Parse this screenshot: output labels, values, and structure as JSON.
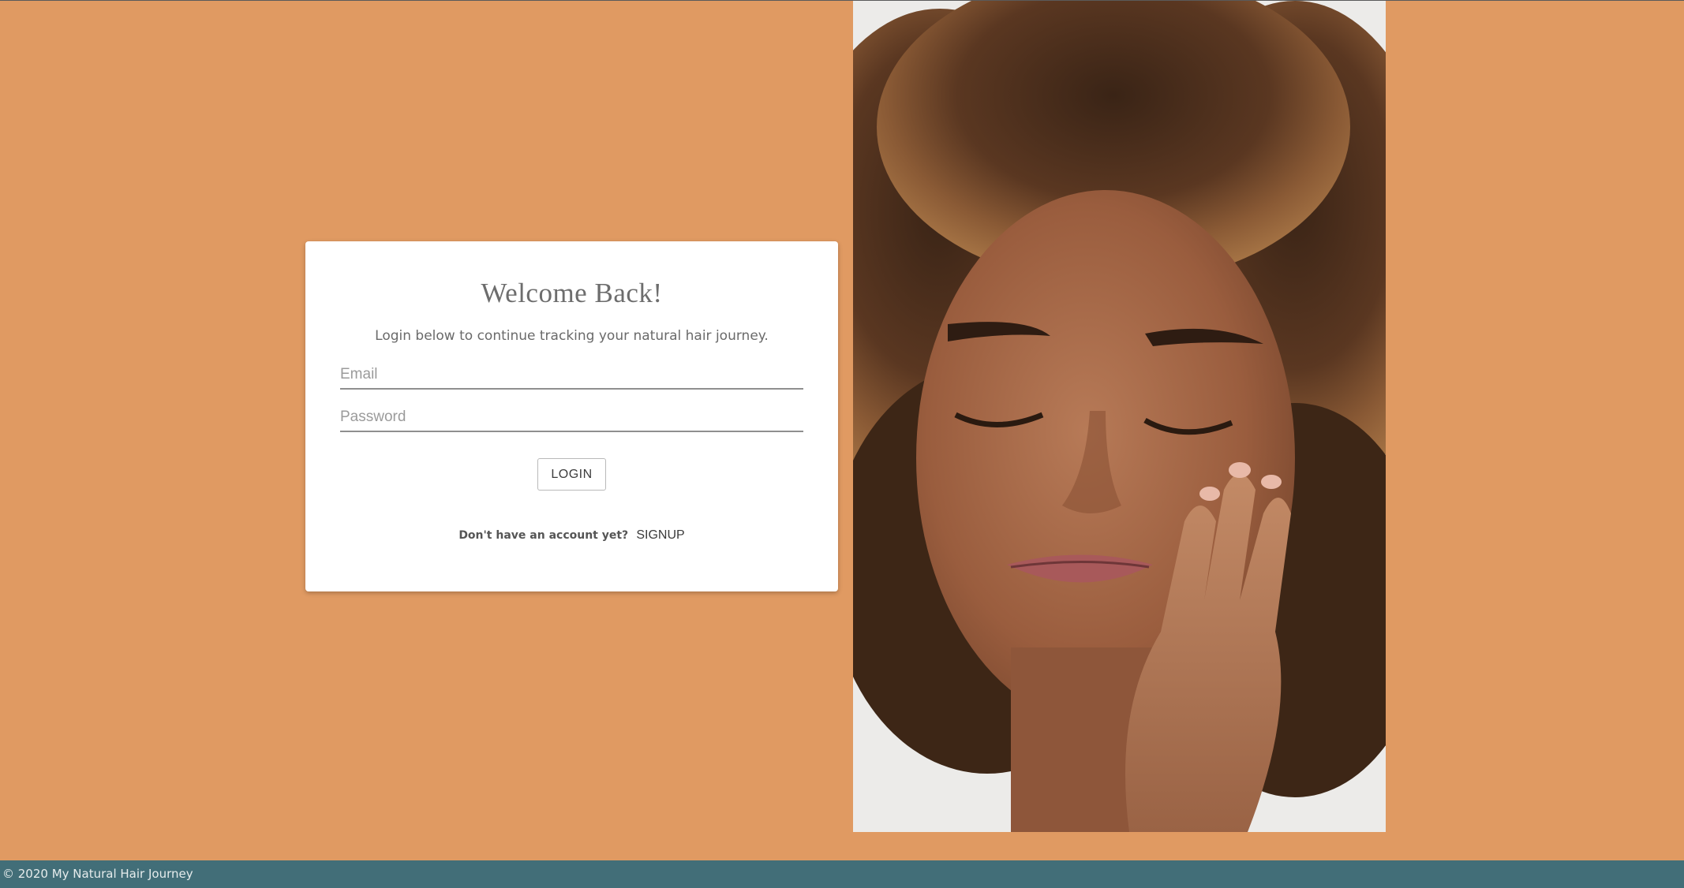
{
  "login": {
    "title": "Welcome Back!",
    "subtitle": "Login below to continue tracking your natural hair journey.",
    "email_placeholder": "Email",
    "email_value": "",
    "password_placeholder": "Password",
    "password_value": "",
    "login_label": "LOGIN",
    "signup_prompt": "Don't have an account yet?",
    "signup_label": "SIGNUP"
  },
  "hero": {
    "image_subject": "woman-with-curly-hair-eyes-closed"
  },
  "footer": {
    "copyright": "© 2020 My Natural Hair Journey"
  },
  "colors": {
    "page_background": "#e09a62",
    "footer_background": "#426e78",
    "card_background": "#ffffff"
  }
}
